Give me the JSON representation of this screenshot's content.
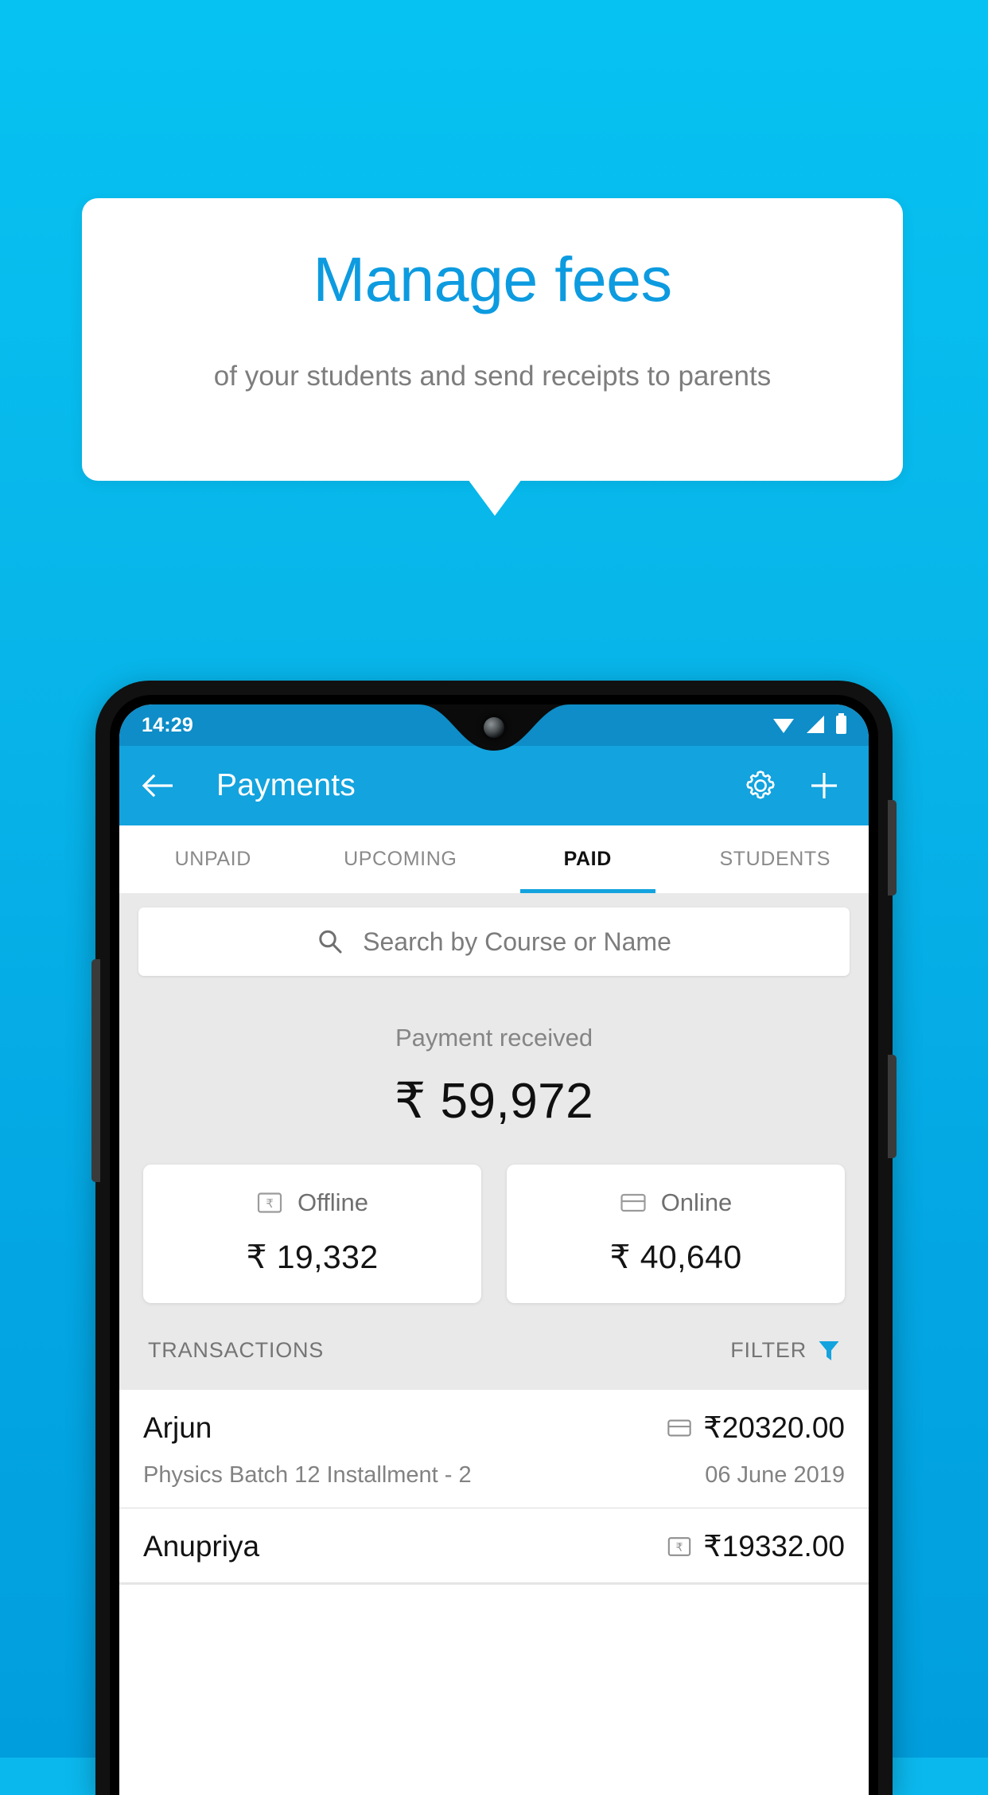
{
  "promo": {
    "title": "Manage fees",
    "subtitle": "of your students and send receipts to parents",
    "title_color": "#0D9BE0",
    "background_color": "#07BEEF"
  },
  "phone": {
    "statusbar": {
      "time": "14:29",
      "icons": [
        "wifi-icon",
        "cell-signal-icon",
        "battery-icon"
      ]
    },
    "appbar": {
      "back_icon": "back-arrow-icon",
      "title": "Payments",
      "settings_icon": "gear-icon",
      "add_icon": "plus-icon",
      "color": "#13A3DE"
    },
    "tabs": [
      {
        "label": "UNPAID",
        "active": false
      },
      {
        "label": "UPCOMING",
        "active": false
      },
      {
        "label": "PAID",
        "active": true
      },
      {
        "label": "STUDENTS",
        "active": false
      }
    ],
    "search": {
      "icon": "search-icon",
      "placeholder": "Search by Course or Name",
      "value": ""
    },
    "summary": {
      "label": "Payment received",
      "amount": "₹ 59,972"
    },
    "methods": [
      {
        "icon": "cash-note-icon",
        "label": "Offline",
        "amount": "₹ 19,332"
      },
      {
        "icon": "credit-card-icon",
        "label": "Online",
        "amount": "₹ 40,640"
      }
    ],
    "transactions_header": {
      "title": "TRANSACTIONS",
      "filter_label": "FILTER",
      "filter_icon": "funnel-icon",
      "filter_color": "#13A3DE"
    },
    "transactions": [
      {
        "name": "Arjun",
        "description": "Physics Batch 12 Installment - 2",
        "amount": "₹20320.00",
        "date": "06 June 2019",
        "method_icon": "credit-card-icon"
      },
      {
        "name": "Anupriya",
        "description": "",
        "amount": "₹19332.00",
        "date": "",
        "method_icon": "cash-note-icon"
      }
    ]
  }
}
